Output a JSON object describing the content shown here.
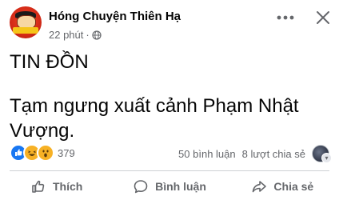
{
  "post": {
    "author": "Hóng Chuyện Thiên Hạ",
    "time": "22 phút",
    "separator": "·",
    "content_line1": "TIN ĐỒN",
    "content_line2": "Tạm ngưng xuất cảnh Phạm Nhật Vượng."
  },
  "stats": {
    "reaction_count": "379",
    "comments": "50 bình luận",
    "shares": "8 lượt chia sẻ",
    "reactions": [
      "like",
      "haha",
      "wow"
    ]
  },
  "actions": {
    "like_label": "Thích",
    "comment_label": "Bình luận",
    "share_label": "Chia sẻ"
  },
  "colors": {
    "text_primary": "#050505",
    "text_secondary": "#65676b",
    "like_blue": "#1877f2",
    "reaction_yellow": "#f7b125",
    "divider": "#ced0d4"
  },
  "icons": {
    "audience": "globe-icon",
    "more": "more-horizontal-icon",
    "close": "close-icon",
    "like": "thumbs-up-icon",
    "comment": "comment-bubble-icon",
    "share": "share-arrow-icon"
  }
}
